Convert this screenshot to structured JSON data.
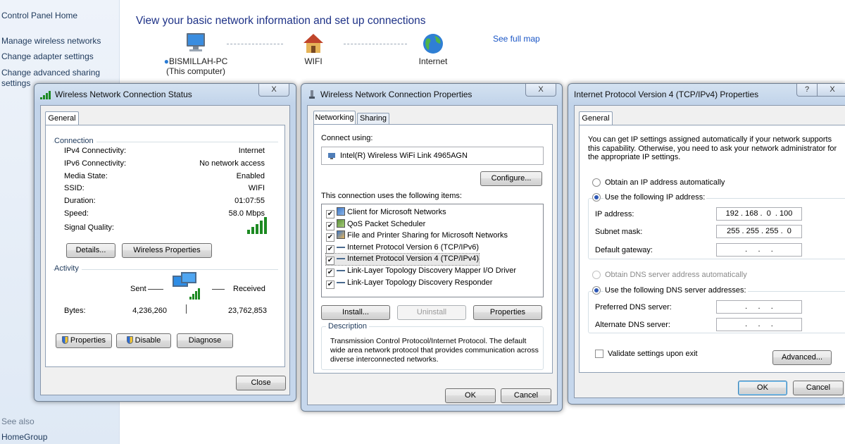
{
  "control_panel": {
    "sidebar": {
      "home": "Control Panel Home",
      "manage_wireless": "Manage wireless networks",
      "change_adapter": "Change adapter settings",
      "change_sharing_1": "Change advanced sharing",
      "change_sharing_2": "settings",
      "see_also": "See also",
      "homegroup": "HomeGroup"
    },
    "title": "View your basic network information and set up connections",
    "see_full_map": "See full map",
    "map": {
      "computer_name": "BISMILLAH-PC",
      "computer_sub": "(This computer)",
      "network": "WIFI",
      "internet": "Internet"
    }
  },
  "status_window": {
    "title": "Wireless Network Connection Status",
    "close_x": "X",
    "tab_general": "General",
    "connection_group": "Connection",
    "rows": [
      {
        "label": "IPv4 Connectivity:",
        "value": "Internet"
      },
      {
        "label": "IPv6 Connectivity:",
        "value": "No network access"
      },
      {
        "label": "Media State:",
        "value": "Enabled"
      },
      {
        "label": "SSID:",
        "value": "WIFI"
      },
      {
        "label": "Duration:",
        "value": "01:07:55"
      },
      {
        "label": "Speed:",
        "value": "58.0 Mbps"
      }
    ],
    "signal_quality_label": "Signal Quality:",
    "details_button": "Details...",
    "wireless_props_button": "Wireless Properties",
    "activity_group": "Activity",
    "sent_label": "Sent",
    "received_label": "Received",
    "bytes_label": "Bytes:",
    "bytes_sent": "4,236,260",
    "bytes_received": "23,762,853",
    "properties_button": "Properties",
    "disable_button": "Disable",
    "diagnose_button": "Diagnose",
    "close_button": "Close"
  },
  "props_window": {
    "title": "Wireless Network Connection Properties",
    "close_x": "X",
    "tab_networking": "Networking",
    "tab_sharing": "Sharing",
    "connect_using_label": "Connect using:",
    "adapter_name": "Intel(R) Wireless WiFi Link 4965AGN",
    "configure_button": "Configure...",
    "items_label": "This connection uses the following items:",
    "items": [
      "Client for Microsoft Networks",
      "QoS Packet Scheduler",
      "File and Printer Sharing for Microsoft Networks",
      "Internet Protocol Version 6 (TCP/IPv6)",
      "Internet Protocol Version 4 (TCP/IPv4)",
      "Link-Layer Topology Discovery Mapper I/O Driver",
      "Link-Layer Topology Discovery Responder"
    ],
    "install_button": "Install...",
    "uninstall_button": "Uninstall",
    "properties_button": "Properties",
    "description_group": "Description",
    "description_text": "Transmission Control Protocol/Internet Protocol. The default wide area network protocol that provides communication across diverse interconnected networks.",
    "ok_button": "OK",
    "cancel_button": "Cancel"
  },
  "ipv4_window": {
    "title": "Internet Protocol Version 4 (TCP/IPv4) Properties",
    "help_x": "?",
    "close_x": "X",
    "tab_general": "General",
    "intro_text": "You can get IP settings assigned automatically if your network supports this capability. Otherwise, you need to ask your network administrator for the appropriate IP settings.",
    "obtain_ip_auto": "Obtain an IP address automatically",
    "use_following_ip": "Use the following IP address:",
    "ip_address_label": "IP address:",
    "ip_address_value": "192 . 168 .  0  . 100",
    "subnet_label": "Subnet mask:",
    "subnet_value": "255 . 255 . 255 .  0",
    "gateway_label": "Default gateway:",
    "gateway_value": "   .     .     .   ",
    "obtain_dns_auto": "Obtain DNS server address automatically",
    "use_following_dns": "Use the following DNS server addresses:",
    "preferred_dns_label": "Preferred DNS server:",
    "preferred_dns_value": "   .     .     .   ",
    "alternate_dns_label": "Alternate DNS server:",
    "alternate_dns_value": "   .     .     .   ",
    "validate_label": "Validate settings upon exit",
    "advanced_button": "Advanced...",
    "ok_button": "OK",
    "cancel_button": "Cancel"
  }
}
